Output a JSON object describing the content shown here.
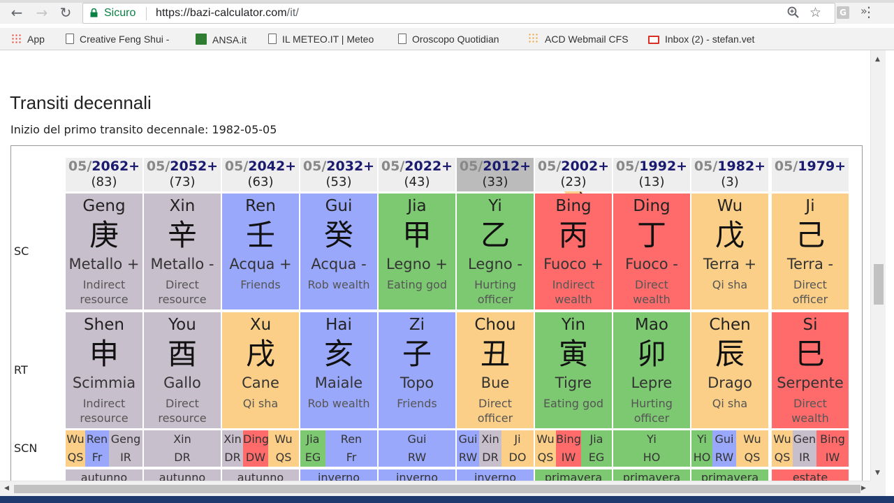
{
  "browser": {
    "secure_label": "Sicuro",
    "url_host": "https://bazi-calculator.com",
    "url_path": "/it/",
    "back_icon": "←",
    "forward_icon": "→",
    "reload_icon": "↻",
    "profile_letter": "G"
  },
  "bookmarks": [
    {
      "label": "App",
      "icon": "apps-grid-icon"
    },
    {
      "label": "Creative Feng Shui -",
      "icon": "page-icon"
    },
    {
      "label": "ANSA.it",
      "icon": "ansa-icon"
    },
    {
      "label": "IL METEO.IT | Meteo",
      "icon": "page-icon"
    },
    {
      "label": "Oroscopo Quotidian",
      "icon": "page-icon"
    },
    {
      "label": "ACD Webmail CFS",
      "icon": "webmail-icon"
    },
    {
      "label": "Inbox (2) - stefan.vet",
      "icon": "gmail-icon"
    }
  ],
  "page": {
    "title": "Transiti decennali",
    "subtitle": "Inizio del primo transito decennale: 1982-05-05",
    "row_labels": {
      "sc": "SC",
      "rt": "RT",
      "scn": "SCN"
    }
  },
  "colors": {
    "orange": "#fbcf87",
    "grey": "#c8bfcc",
    "blue": "#9aa8fb",
    "green": "#7dc972",
    "red": "#ff6b6b"
  },
  "columns": [
    {
      "month": "05/",
      "year": "2062+",
      "age": "(83)",
      "sc": {
        "pinyin": "Geng",
        "hanzi": "庚",
        "element": "Metallo +",
        "god": [
          "Indirect",
          "resource"
        ],
        "color": "grey"
      },
      "rt": {
        "pinyin": "Shen",
        "hanzi": "申",
        "animal": "Scimmia",
        "god": [
          "Indirect",
          "resource"
        ],
        "color": "grey"
      },
      "scn": [
        {
          "t": "Wu",
          "b": "QS",
          "color": "orange",
          "w": 28
        },
        {
          "t": "Ren",
          "b": "Fr",
          "color": "blue",
          "w": 34
        },
        {
          "t": "Geng",
          "b": "IR",
          "color": "grey",
          "w": 48
        }
      ],
      "season": {
        "label": "autunno",
        "color": "grey"
      }
    },
    {
      "month": "05/",
      "year": "2052+",
      "age": "(73)",
      "sc": {
        "pinyin": "Xin",
        "hanzi": "辛",
        "element": "Metallo -",
        "god": [
          "Direct",
          "resource"
        ],
        "color": "grey"
      },
      "rt": {
        "pinyin": "You",
        "hanzi": "酉",
        "animal": "Gallo",
        "god": [
          "Direct",
          "resource"
        ],
        "color": "grey"
      },
      "scn": [
        {
          "t": "Xin",
          "b": "DR",
          "color": "grey",
          "w": 110
        }
      ],
      "season": {
        "label": "autunno",
        "color": "grey"
      }
    },
    {
      "month": "05/",
      "year": "2042+",
      "age": "(63)",
      "sc": {
        "pinyin": "Ren",
        "hanzi": "壬",
        "element": "Acqua +",
        "god": [
          "Friends"
        ],
        "color": "blue"
      },
      "rt": {
        "pinyin": "Xu",
        "hanzi": "戌",
        "animal": "Cane",
        "god": [
          "Qi sha"
        ],
        "color": "orange"
      },
      "scn": [
        {
          "t": "Xin",
          "b": "DR",
          "color": "grey",
          "w": 30
        },
        {
          "t": "Ding",
          "b": "DW",
          "color": "red",
          "w": 36
        },
        {
          "t": "Wu",
          "b": "QS",
          "color": "orange",
          "w": 44
        }
      ],
      "season": {
        "label": "autunno",
        "color": "grey"
      }
    },
    {
      "month": "05/",
      "year": "2032+",
      "age": "(53)",
      "sc": {
        "pinyin": "Gui",
        "hanzi": "癸",
        "element": "Acqua -",
        "god": [
          "Rob wealth"
        ],
        "color": "blue"
      },
      "rt": {
        "pinyin": "Hai",
        "hanzi": "亥",
        "animal": "Maiale",
        "god": [
          "Rob wealth"
        ],
        "color": "blue"
      },
      "scn": [
        {
          "t": "Jia",
          "b": "EG",
          "color": "green",
          "w": 36
        },
        {
          "t": "Ren",
          "b": "Fr",
          "color": "blue",
          "w": 74
        }
      ],
      "season": {
        "label": "inverno",
        "color": "blue"
      }
    },
    {
      "month": "05/",
      "year": "2022+",
      "age": "(43)",
      "sc": {
        "pinyin": "Jia",
        "hanzi": "甲",
        "element": "Legno +",
        "god": [
          "Eating god"
        ],
        "color": "green"
      },
      "rt": {
        "pinyin": "Zi",
        "hanzi": "子",
        "animal": "Topo",
        "god": [
          "Friends"
        ],
        "color": "blue"
      },
      "scn": [
        {
          "t": "Gui",
          "b": "RW",
          "color": "blue",
          "w": 110
        }
      ],
      "season": {
        "label": "inverno",
        "color": "blue"
      }
    },
    {
      "month": "05/",
      "year": "2012+",
      "age": "(33)",
      "highlight": true,
      "sc": {
        "pinyin": "Yi",
        "hanzi": "乙",
        "element": "Legno -",
        "god": [
          "Hurting",
          "officer"
        ],
        "color": "green"
      },
      "rt": {
        "pinyin": "Chou",
        "hanzi": "丑",
        "animal": "Bue",
        "god": [
          "Direct",
          "officer"
        ],
        "color": "orange"
      },
      "scn": [
        {
          "t": "Gui",
          "b": "RW",
          "color": "blue",
          "w": 32
        },
        {
          "t": "Xin",
          "b": "DR",
          "color": "grey",
          "w": 32
        },
        {
          "t": "Ji",
          "b": "DO",
          "color": "orange",
          "w": 46
        }
      ],
      "season": {
        "label": "inverno",
        "color": "blue"
      }
    },
    {
      "month": "05/",
      "year": "2002+",
      "age": "(23)",
      "sc": {
        "pinyin": "Bing",
        "hanzi": "丙",
        "element": "Fuoco +",
        "god": [
          "Indirect",
          "wealth"
        ],
        "color": "red"
      },
      "rt": {
        "pinyin": "Yin",
        "hanzi": "寅",
        "animal": "Tigre",
        "god": [
          "Eating god"
        ],
        "color": "green"
      },
      "scn": [
        {
          "t": "Wu",
          "b": "QS",
          "color": "orange",
          "w": 30
        },
        {
          "t": "Bing",
          "b": "IW",
          "color": "red",
          "w": 36
        },
        {
          "t": "Jia",
          "b": "EG",
          "color": "green",
          "w": 44
        }
      ],
      "season": {
        "label": "primavera",
        "color": "green"
      }
    },
    {
      "month": "05/",
      "year": "1992+",
      "age": "(13)",
      "sc": {
        "pinyin": "Ding",
        "hanzi": "丁",
        "element": "Fuoco -",
        "god": [
          "Direct",
          "wealth"
        ],
        "color": "red"
      },
      "rt": {
        "pinyin": "Mao",
        "hanzi": "卯",
        "animal": "Lepre",
        "god": [
          "Hurting",
          "officer"
        ],
        "color": "green"
      },
      "scn": [
        {
          "t": "Yi",
          "b": "HO",
          "color": "green",
          "w": 110
        }
      ],
      "season": {
        "label": "primavera",
        "color": "green"
      }
    },
    {
      "month": "05/",
      "year": "1982+",
      "age": "(3)",
      "sc": {
        "pinyin": "Wu",
        "hanzi": "戊",
        "element": "Terra +",
        "god": [
          "Qi sha"
        ],
        "color": "orange"
      },
      "rt": {
        "pinyin": "Chen",
        "hanzi": "辰",
        "animal": "Drago",
        "god": [
          "Qi sha"
        ],
        "color": "orange"
      },
      "scn": [
        {
          "t": "Yi",
          "b": "HO",
          "color": "green",
          "w": 30
        },
        {
          "t": "Gui",
          "b": "RW",
          "color": "blue",
          "w": 34
        },
        {
          "t": "Wu",
          "b": "QS",
          "color": "orange",
          "w": 46
        }
      ],
      "season": {
        "label": "primavera",
        "color": "green"
      }
    },
    {
      "month": "05/",
      "year": "1979+",
      "age": "",
      "sc": {
        "pinyin": "Ji",
        "hanzi": "己",
        "element": "Terra -",
        "god": [
          "Direct",
          "officer"
        ],
        "color": "orange"
      },
      "rt": {
        "pinyin": "Si",
        "hanzi": "巳",
        "animal": "Serpente",
        "god": [
          "Direct",
          "wealth"
        ],
        "color": "red"
      },
      "scn": [
        {
          "t": "Wu",
          "b": "QS",
          "color": "orange",
          "w": 30
        },
        {
          "t": "Gen",
          "b": "IR",
          "color": "grey",
          "w": 34
        },
        {
          "t": "Bing",
          "b": "IW",
          "color": "red",
          "w": 46
        }
      ],
      "season": {
        "label": "estate",
        "color": "red"
      }
    }
  ]
}
